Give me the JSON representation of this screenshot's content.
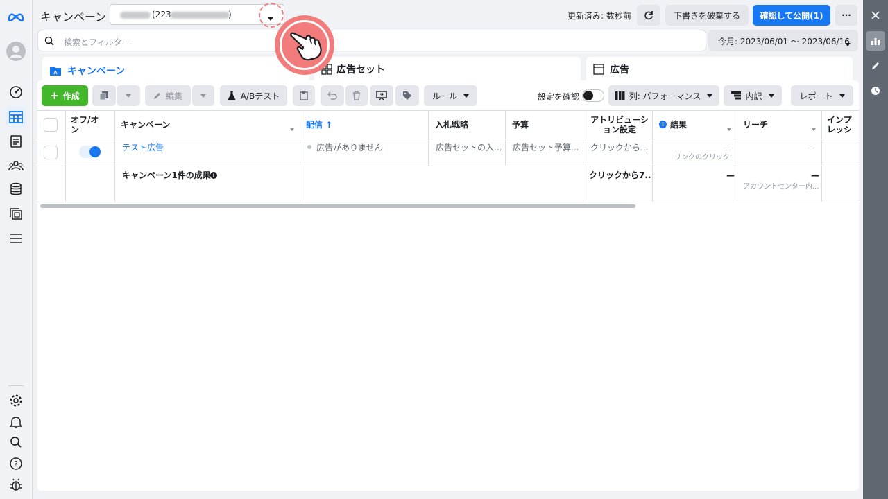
{
  "header": {
    "title": "キャンペーン",
    "account_prefix": "(223",
    "account_suffix": ")",
    "updated": "更新済み: 数秒前",
    "discard_label": "下書きを破棄する",
    "publish_label": "確認して公開(1)",
    "more_label": "···"
  },
  "search": {
    "placeholder": "検索とフィルター"
  },
  "date_range": "今月: 2023/06/01 〜 2023/06/16",
  "tabs": [
    {
      "label": "キャンペーン"
    },
    {
      "label": "広告セット"
    },
    {
      "label": "広告"
    }
  ],
  "toolbar": {
    "create_label": "作成",
    "edit_label": "編集",
    "ab_label": "A/Bテスト",
    "rules_label": "ルール",
    "settings_label": "設定を確認",
    "columns_label": "列: パフォーマンス",
    "breakdown_label": "内訳",
    "report_label": "レポート"
  },
  "table": {
    "headers": {
      "toggle": "オフ/オン",
      "campaign": "キャンペーン",
      "delivery": "配信 ↑",
      "bid": "入札戦略",
      "budget": "予算",
      "attribution": "アトリビューション設定",
      "results": "結果",
      "reach": "リーチ",
      "impressions": "インプレッション"
    },
    "row": {
      "campaign": "テスト広告",
      "delivery": "広告がありません",
      "bid": "広告セットの入...",
      "budget": "広告セット予算...",
      "attribution": "クリックから...",
      "results": "—",
      "results_sub": "リンクのクリック",
      "reach": "—"
    },
    "summary": {
      "label": "キャンペーン1件の成果",
      "attribution": "クリックから7...",
      "results": "—",
      "reach": "—",
      "reach_sub": "アカウントセンター内..."
    }
  },
  "colors": {
    "accent": "#1877f2",
    "create": "#42b72a",
    "highlight": "#f08080"
  }
}
